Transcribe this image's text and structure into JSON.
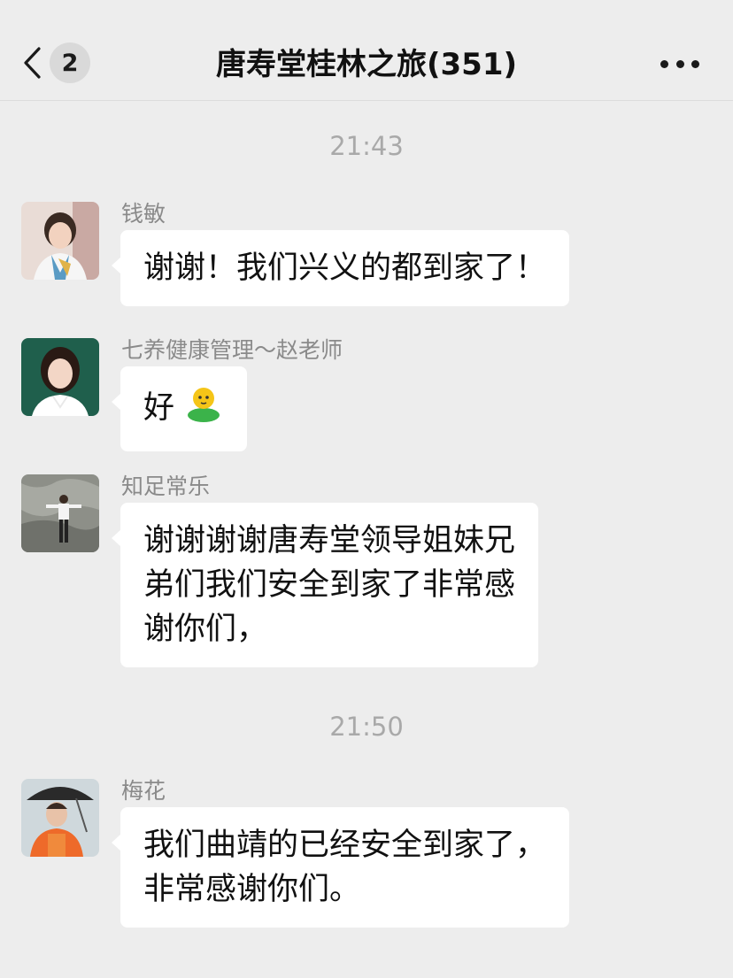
{
  "header": {
    "back_badge": "2",
    "title": "唐寿堂桂林之旅(351)"
  },
  "timestamps": [
    "21:43",
    "21:50"
  ],
  "messages": [
    {
      "sender": "钱敏",
      "text": "谢谢！我们兴义的都到家了！"
    },
    {
      "sender": "七养健康管理～赵老师",
      "text": "好",
      "emoji": "green-figure-emoji"
    },
    {
      "sender": "知足常乐",
      "lines": [
        "谢谢谢谢唐寿堂领导姐妹兄",
        "弟们我们安全到家了非常感",
        "谢你们，"
      ]
    },
    {
      "sender": "梅花",
      "lines": [
        "我们曲靖的已经安全到家了，",
        "非常感谢你们。"
      ]
    }
  ],
  "colors": {
    "background": "#ededed",
    "bubble": "#ffffff",
    "timestamp": "#a9a9a9",
    "sender": "#8a8a8a"
  }
}
